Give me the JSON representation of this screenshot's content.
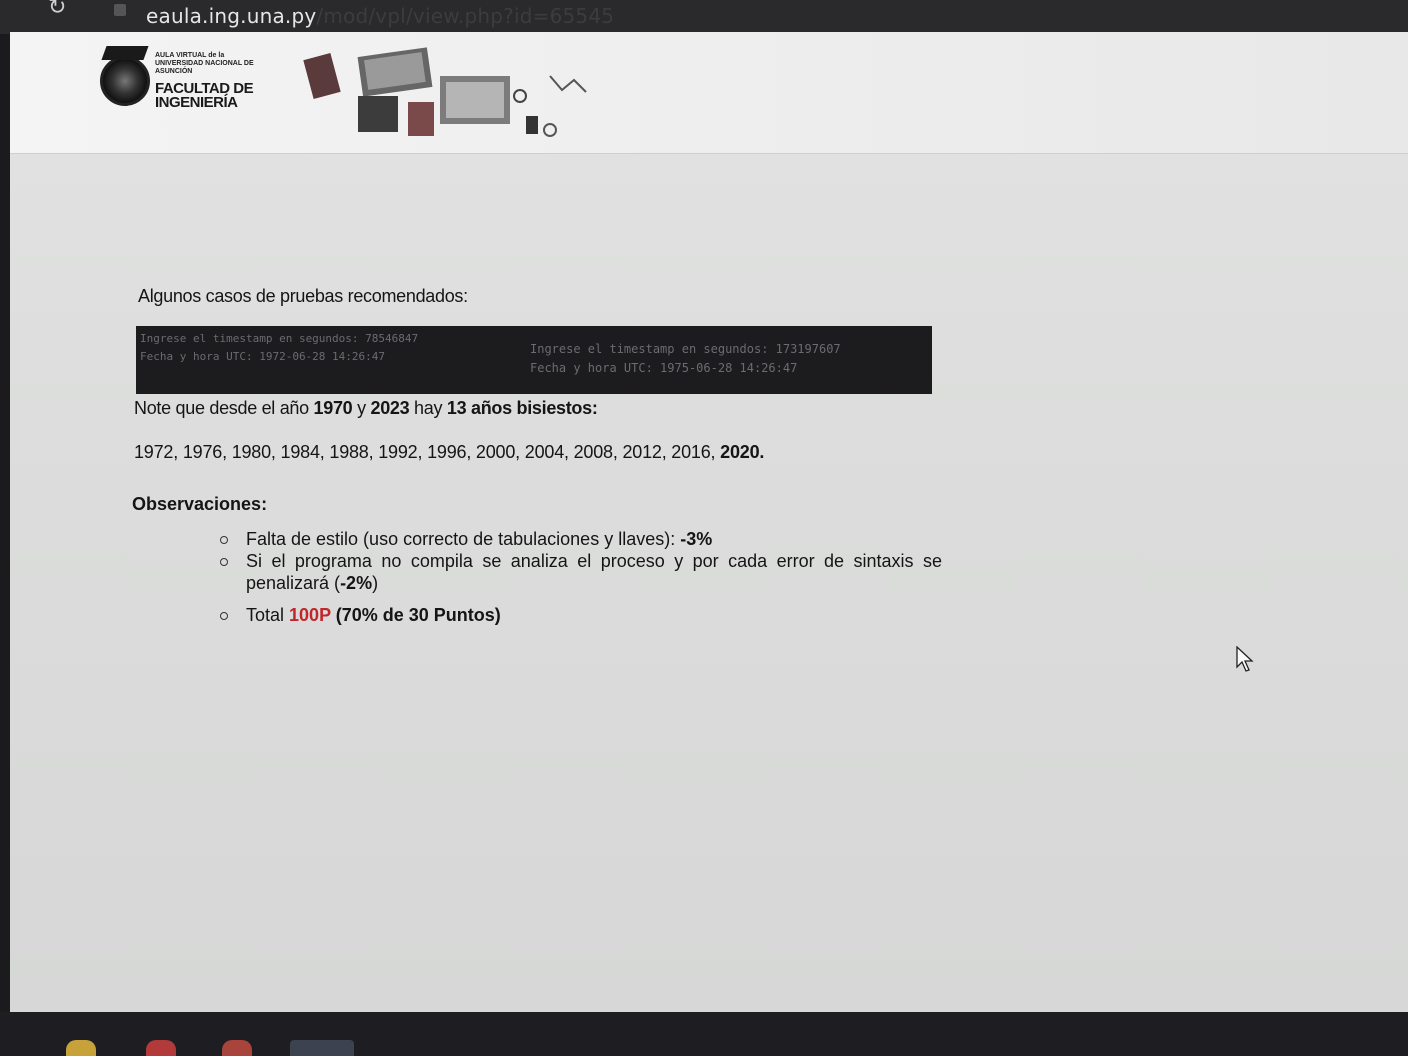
{
  "browser": {
    "url_host": "eaula.ing.una.py",
    "url_path": "/mod/vpl/view.php?id=65545"
  },
  "header": {
    "logo_small": "AULA VIRTUAL de la UNIVERSIDAD NACIONAL DE ASUNCIÓN",
    "logo_big_1": "FACULTAD DE",
    "logo_big_2": "INGENIERÍA"
  },
  "content": {
    "tests_heading": "Algunos casos de pruebas recomendados:",
    "terminal": {
      "left_line_1": "Ingrese el timestamp en segundos: 78546847",
      "left_line_2": "Fecha y hora UTC: 1972-06-28 14:26:47",
      "right_line_1": "Ingrese el timestamp en segundos: 173197607",
      "right_line_2": "Fecha y hora UTC: 1975-06-28 14:26:47"
    },
    "note": {
      "p1": "Note que desde el año ",
      "y1": "1970",
      "p2": " y ",
      "y2": "2023",
      "p3": " hay ",
      "count": "13 años bisiestos:"
    },
    "years_list": "1972, 1976, 1980, 1984, 1988, 1992, 1996, 2000, 2004, 2008, 2012, 2016, ",
    "years_last": "2020.",
    "observations_heading": "Observaciones:",
    "observations": {
      "item1_text": "Falta de estilo (uso correcto de tabulaciones y llaves): ",
      "item1_value": "-3%",
      "item2_text": "Si el programa no compila se analiza el proceso y por cada error de sintaxis se penalizará (",
      "item2_value": "-2%",
      "item2_end": ")",
      "item3_text": "Total ",
      "item3_points": "100P",
      "item3_detail": " (70% de 30 Puntos)"
    }
  }
}
